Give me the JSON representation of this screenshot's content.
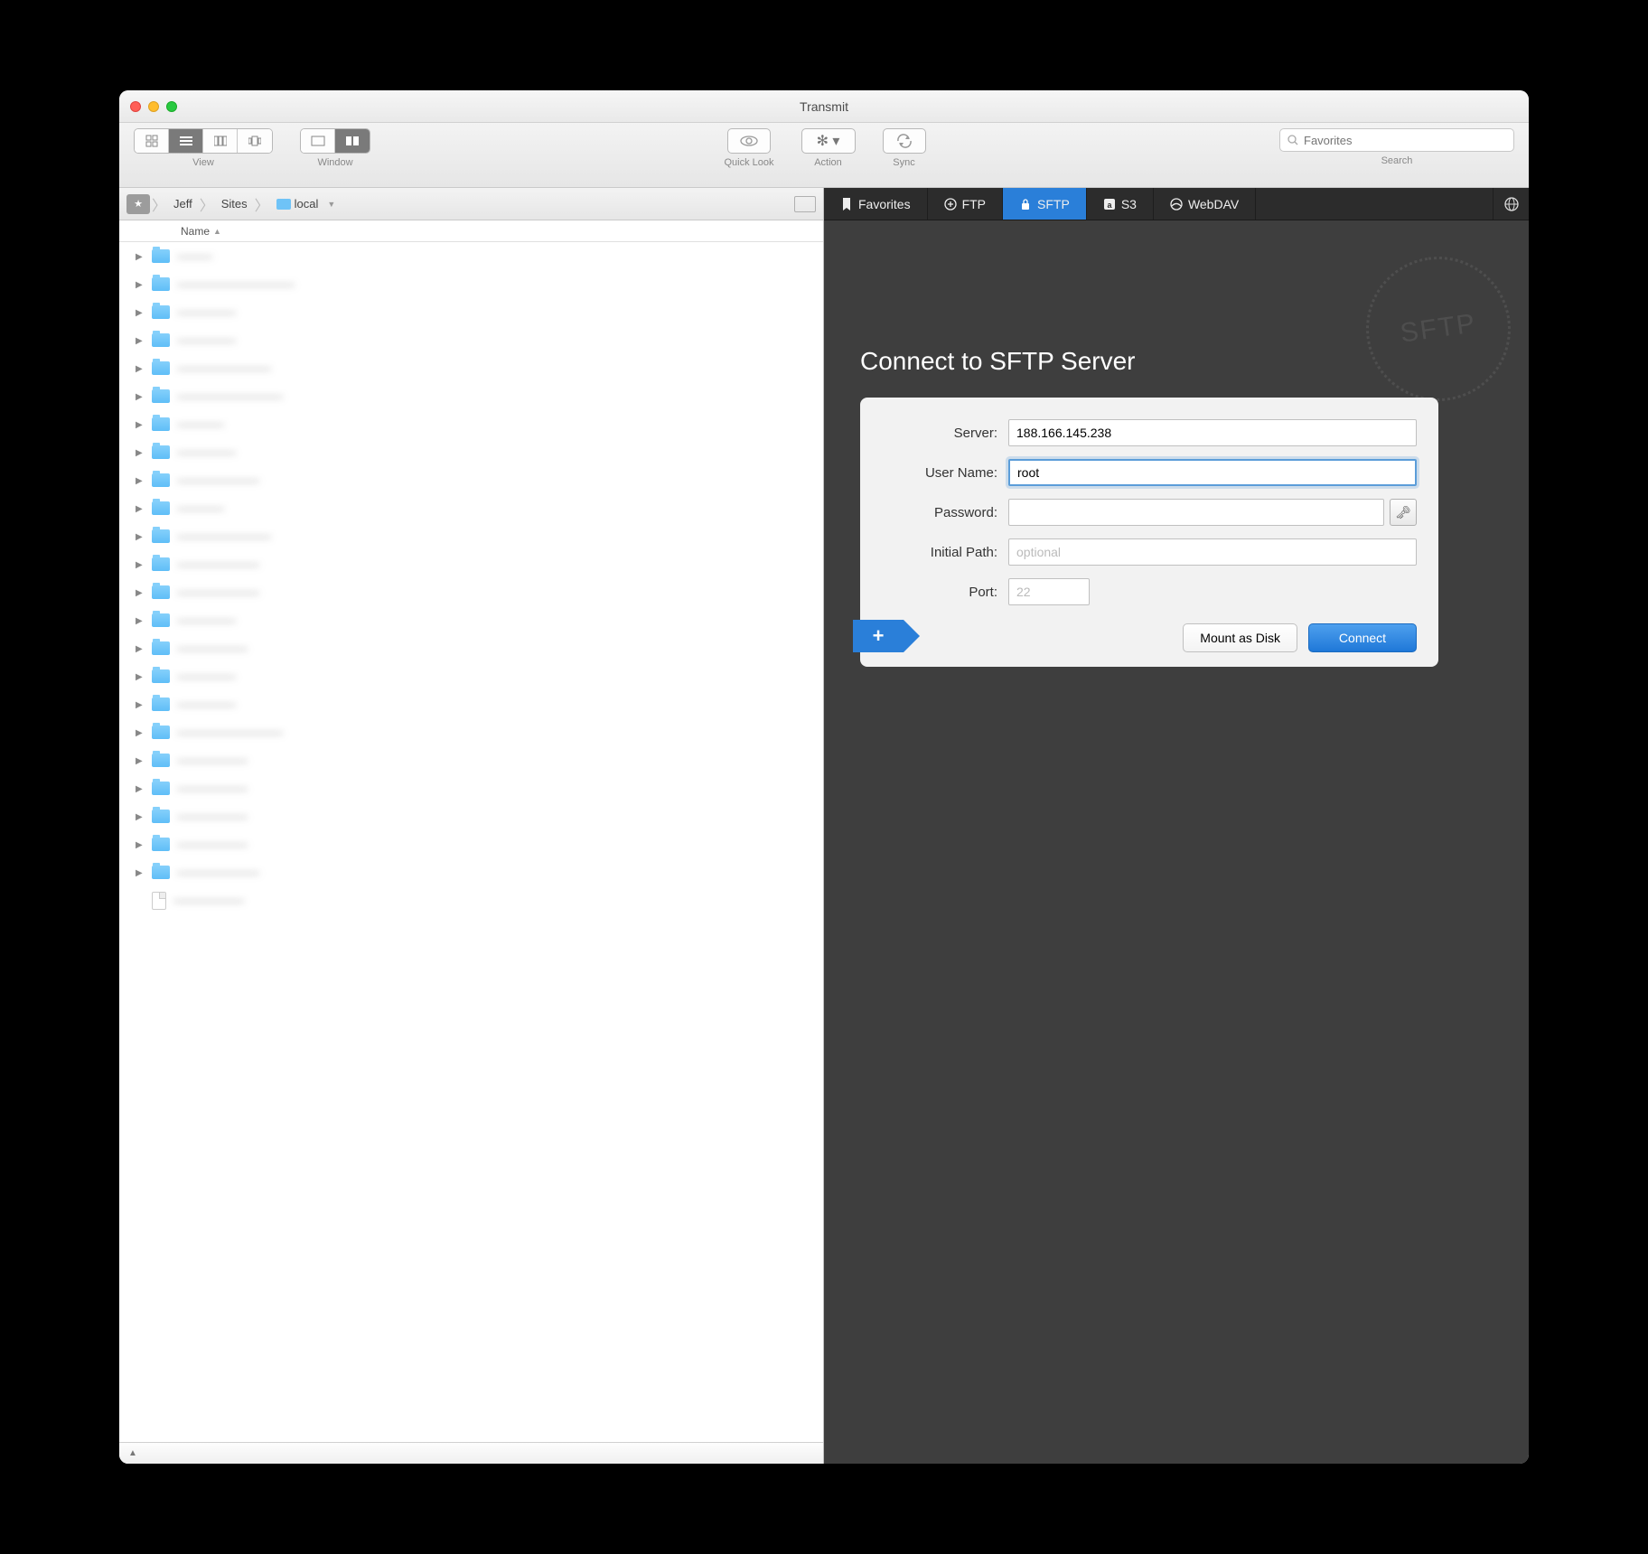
{
  "window": {
    "title": "Transmit"
  },
  "toolbar": {
    "view_label": "View",
    "window_label": "Window",
    "quicklook_label": "Quick Look",
    "action_label": "Action",
    "sync_label": "Sync",
    "search_label": "Search",
    "search_placeholder": "Favorites"
  },
  "path": {
    "crumbs": [
      "Jeff",
      "Sites",
      "local"
    ],
    "current_index": 2
  },
  "list": {
    "header": "Name",
    "items": [
      {
        "type": "folder",
        "name": "———"
      },
      {
        "type": "folder",
        "name": "——————————"
      },
      {
        "type": "folder",
        "name": "—————"
      },
      {
        "type": "folder",
        "name": "—————"
      },
      {
        "type": "folder",
        "name": "————————"
      },
      {
        "type": "folder",
        "name": "—————————"
      },
      {
        "type": "folder",
        "name": "————"
      },
      {
        "type": "folder",
        "name": "—————"
      },
      {
        "type": "folder",
        "name": "———————"
      },
      {
        "type": "folder",
        "name": "————"
      },
      {
        "type": "folder",
        "name": "————————"
      },
      {
        "type": "folder",
        "name": "———————"
      },
      {
        "type": "folder",
        "name": "———————"
      },
      {
        "type": "folder",
        "name": "—————"
      },
      {
        "type": "folder",
        "name": "——————"
      },
      {
        "type": "folder",
        "name": "—————"
      },
      {
        "type": "folder",
        "name": "—————"
      },
      {
        "type": "folder",
        "name": "—————————"
      },
      {
        "type": "folder",
        "name": "——————"
      },
      {
        "type": "folder",
        "name": "——————"
      },
      {
        "type": "folder",
        "name": "——————"
      },
      {
        "type": "folder",
        "name": "——————"
      },
      {
        "type": "folder",
        "name": "———————"
      },
      {
        "type": "file",
        "name": "——————"
      }
    ]
  },
  "right_tabs": {
    "favorites": "Favorites",
    "ftp": "FTP",
    "sftp": "SFTP",
    "s3": "S3",
    "webdav": "WebDAV"
  },
  "connect": {
    "heading": "Connect to SFTP Server",
    "stamp": "SFTP",
    "server_label": "Server:",
    "server_value": "188.166.145.238",
    "username_label": "User Name:",
    "username_value": "root",
    "password_label": "Password:",
    "password_value": "",
    "initialpath_label": "Initial Path:",
    "initialpath_placeholder": "optional",
    "initialpath_value": "",
    "port_label": "Port:",
    "port_placeholder": "22",
    "port_value": "",
    "mount_label": "Mount as Disk",
    "connect_label": "Connect",
    "add_label": "+"
  }
}
